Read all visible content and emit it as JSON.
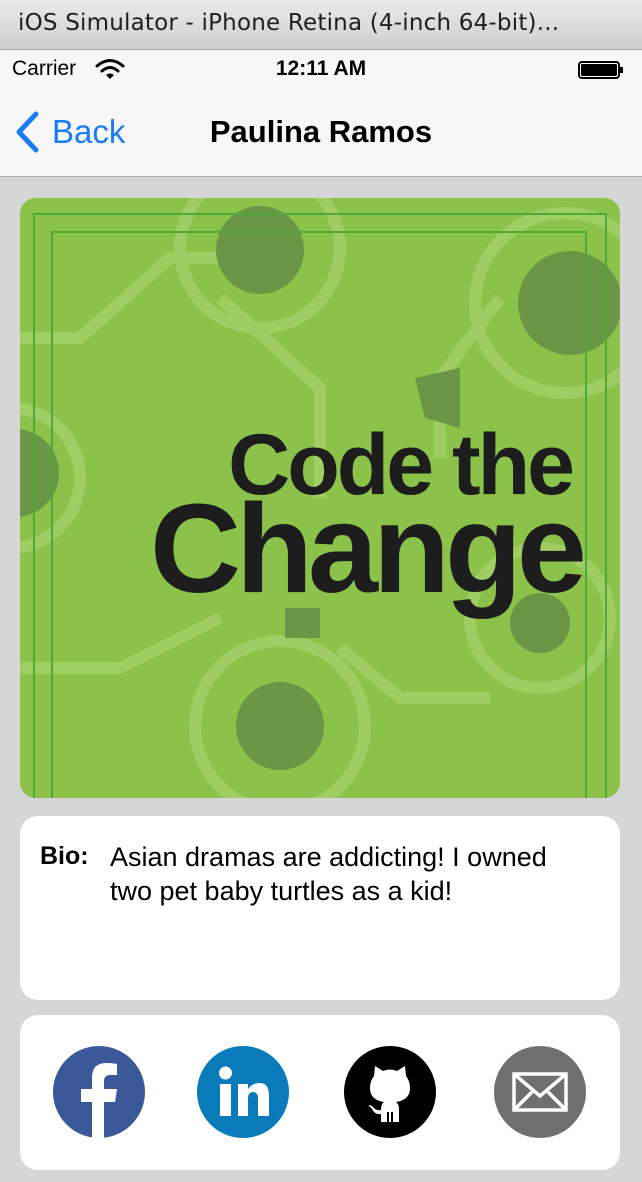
{
  "simulator": {
    "window_title": "iOS Simulator - iPhone Retina (4-inch 64-bit)..."
  },
  "status_bar": {
    "carrier": "Carrier",
    "time": "12:11 AM",
    "wifi_icon": "wifi-icon",
    "battery_icon": "battery-icon"
  },
  "nav": {
    "back_label": "Back",
    "back_icon": "chevron-left-icon",
    "title": "Paulina Ramos"
  },
  "hero_image": {
    "logo_line1": "Code the",
    "logo_line2": "Change",
    "background_color": "#8bc34a"
  },
  "bio": {
    "label": "Bio:",
    "text": "Asian dramas are addicting! I owned two pet baby turtles as a kid!"
  },
  "social": [
    {
      "name": "facebook",
      "icon": "facebook-icon",
      "color": "#3b5998"
    },
    {
      "name": "linkedin",
      "icon": "linkedin-icon",
      "color": "#0a7bba"
    },
    {
      "name": "github",
      "icon": "github-icon",
      "color": "#000000"
    },
    {
      "name": "email",
      "icon": "email-icon",
      "color": "#6f6f6f"
    }
  ]
}
